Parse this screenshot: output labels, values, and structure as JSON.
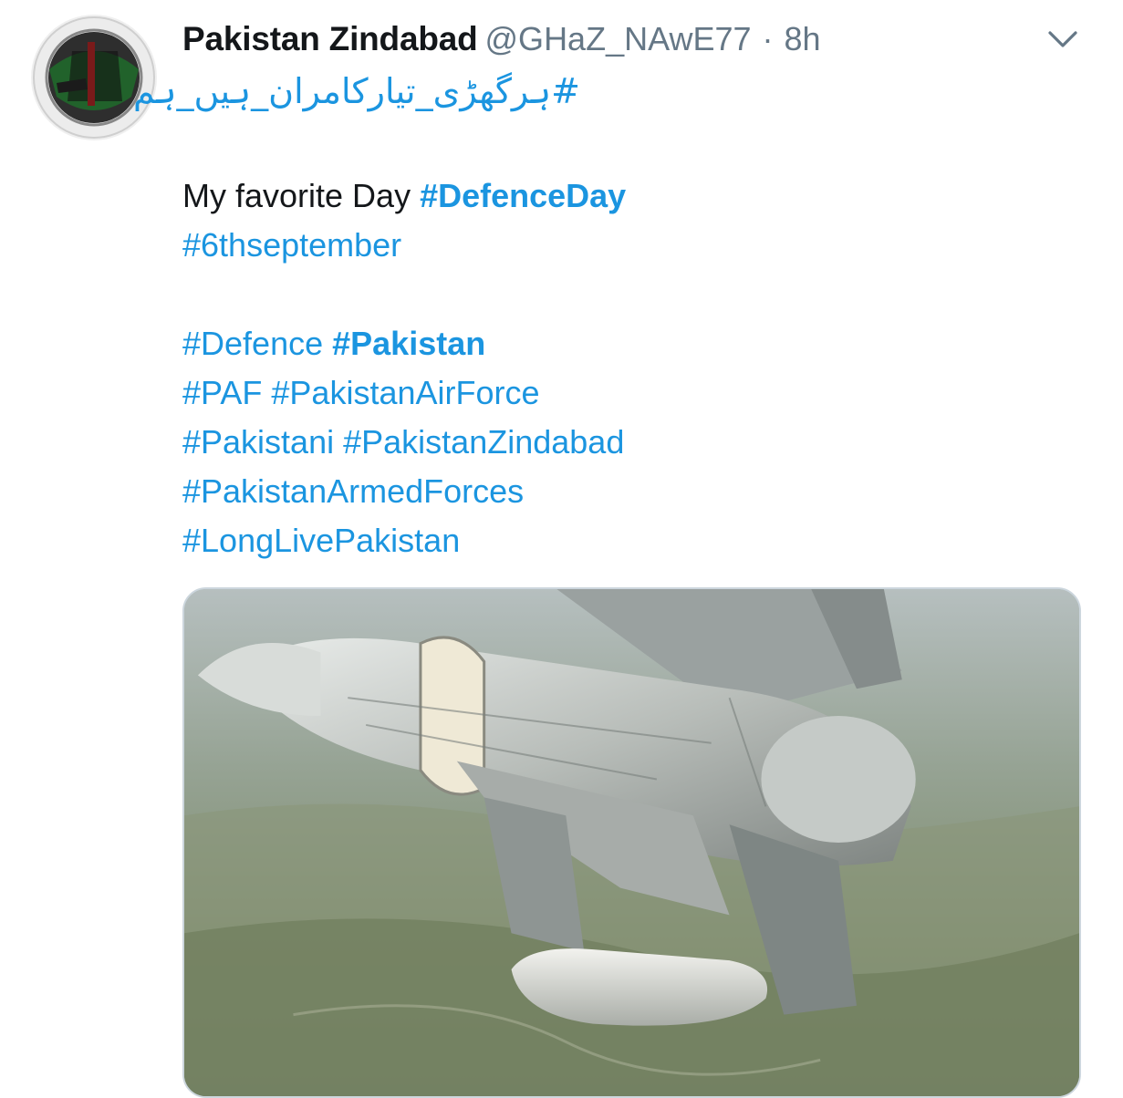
{
  "tweet": {
    "display_name": "Pakistan Zindabad",
    "handle": "@GHaZ_NAwE77",
    "separator": "·",
    "time": "8h",
    "urdu_hashtag": "#ہرگھڑی_تیارکامران_ہیں_ہم",
    "body": {
      "line1_text": "My favorite Day ",
      "line1_tag": "#DefenceDay",
      "line2_tag": "#6thseptember",
      "line3_tag1": "#Defence",
      "line3_tag2": "#Pakistan",
      "line4_tag1": "#PAF",
      "line4_tag2": "#PakistanAirForce",
      "line5_tag1": "#Pakistani",
      "line5_tag2": "#PakistanZindabad",
      "line6_tag": "#PakistanArmedForces",
      "line7_tag": "#LongLivePakistan"
    },
    "media": {
      "description_icon": "fighter-jet-photo"
    }
  },
  "colors": {
    "link": "#1b95e0",
    "text": "#14171a",
    "secondary": "#657786",
    "border": "#ccd6dd"
  },
  "icons": {
    "menu": "chevron-down-icon",
    "avatar": "avatar-emblem"
  }
}
